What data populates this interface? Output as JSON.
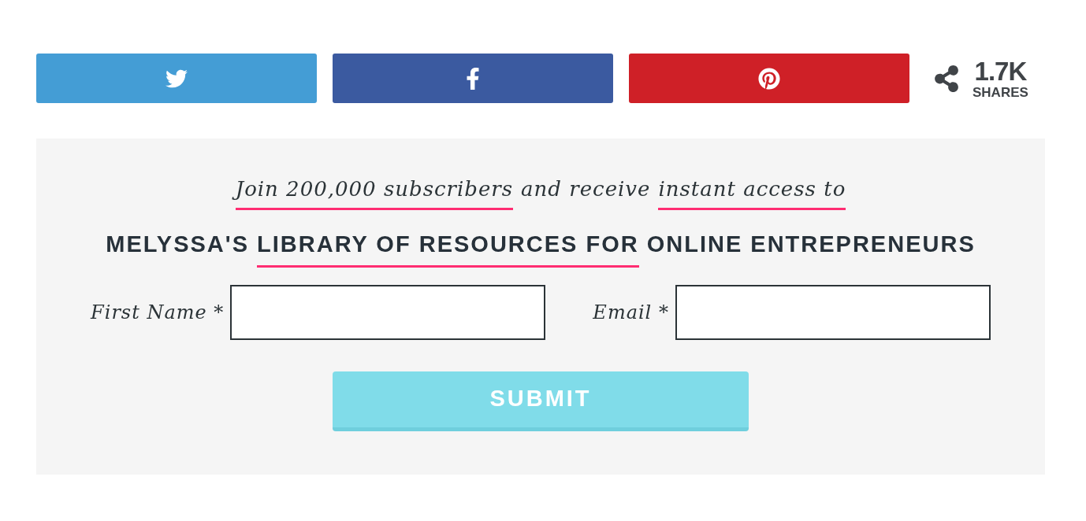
{
  "share_buttons": [
    {
      "kind": "twitter",
      "color": "#449dd5"
    },
    {
      "kind": "facebook",
      "color": "#3b5aa0"
    },
    {
      "kind": "pinterest",
      "color": "#cf2027"
    }
  ],
  "share_count": {
    "count": "1.7K",
    "label": "SHARES"
  },
  "signup": {
    "intro": [
      {
        "text": "Join 200,000 subscribers",
        "underlined": true
      },
      {
        "text": "and receive",
        "underlined": false
      },
      {
        "text": "instant access to",
        "underlined": true
      }
    ],
    "headline": [
      {
        "text": "MELYSSA'S",
        "underlined": false
      },
      {
        "text": "LIBRARY OF RESOURCES FOR",
        "underlined": true
      },
      {
        "text": "ONLINE ENTREPRENEURS",
        "underlined": false
      }
    ],
    "fields": [
      {
        "label": "First Name *"
      },
      {
        "label": "Email *"
      }
    ],
    "submit": "SUBMIT"
  }
}
